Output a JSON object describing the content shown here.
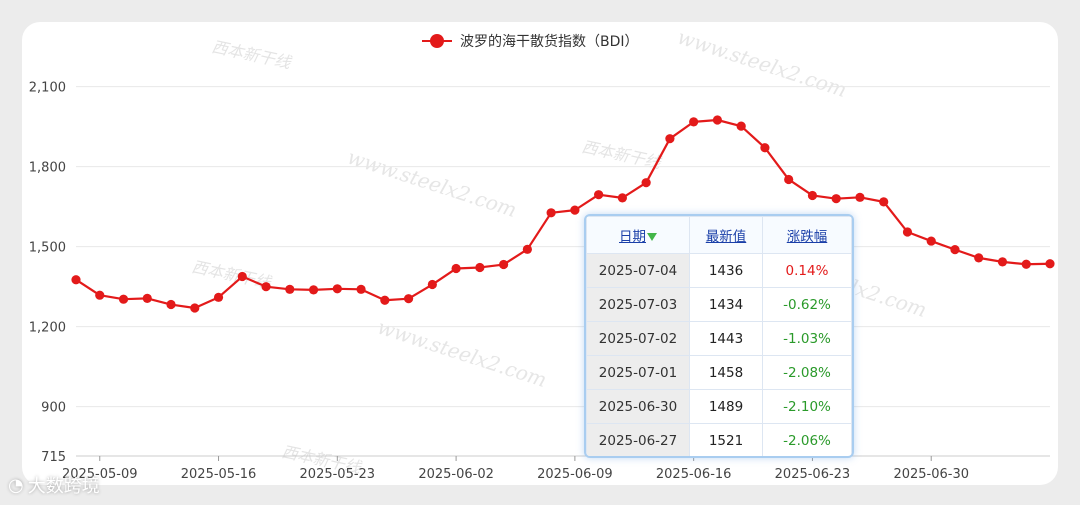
{
  "chart_data": {
    "type": "line",
    "legend": {
      "position": "top-center"
    },
    "ylim": [
      715,
      2200
    ],
    "yticks": [
      715,
      900,
      1200,
      1500,
      1800,
      2100
    ],
    "ytick_labels": [
      "715",
      "900",
      "1,200",
      "1,500",
      "1,800",
      "2,100"
    ],
    "xtick_labels": [
      "2025-05-09",
      "2025-05-16",
      "2025-05-23",
      "2025-06-02",
      "2025-06-09",
      "2025-06-16",
      "2025-06-23",
      "2025-06-30"
    ],
    "series": [
      {
        "name": "波罗的海干散货指数（BDI）",
        "color": "#e31a1a",
        "values": [
          1376,
          1318,
          1303,
          1306,
          1283,
          1270,
          1310,
          1388,
          1350,
          1340,
          1338,
          1342,
          1340,
          1299,
          1305,
          1358,
          1418,
          1422,
          1433,
          1490,
          1627,
          1637,
          1695,
          1683,
          1740,
          1905,
          1968,
          1975,
          1952,
          1871,
          1752,
          1692,
          1680,
          1685,
          1668,
          1555,
          1521,
          1489,
          1458,
          1443,
          1434,
          1436
        ]
      }
    ]
  },
  "tooltip": {
    "headers": [
      "日期",
      "最新值",
      "涨跌幅"
    ],
    "rows": [
      {
        "date": "2025-07-04",
        "value": "1436",
        "change": "0.14%",
        "dir": "up"
      },
      {
        "date": "2025-07-03",
        "value": "1434",
        "change": "-0.62%",
        "dir": "down"
      },
      {
        "date": "2025-07-02",
        "value": "1443",
        "change": "-1.03%",
        "dir": "down"
      },
      {
        "date": "2025-07-01",
        "value": "1458",
        "change": "-2.08%",
        "dir": "down"
      },
      {
        "date": "2025-06-30",
        "value": "1489",
        "change": "-2.10%",
        "dir": "down"
      },
      {
        "date": "2025-06-27",
        "value": "1521",
        "change": "-2.06%",
        "dir": "down"
      }
    ]
  },
  "watermarks": {
    "site": "www.steelx2.com",
    "brand": "西本新干线",
    "corner": "大数跨境"
  },
  "colors": {
    "up": "#e31a1a",
    "down": "#2a9a2a",
    "header_link": "#1a3fa8"
  }
}
